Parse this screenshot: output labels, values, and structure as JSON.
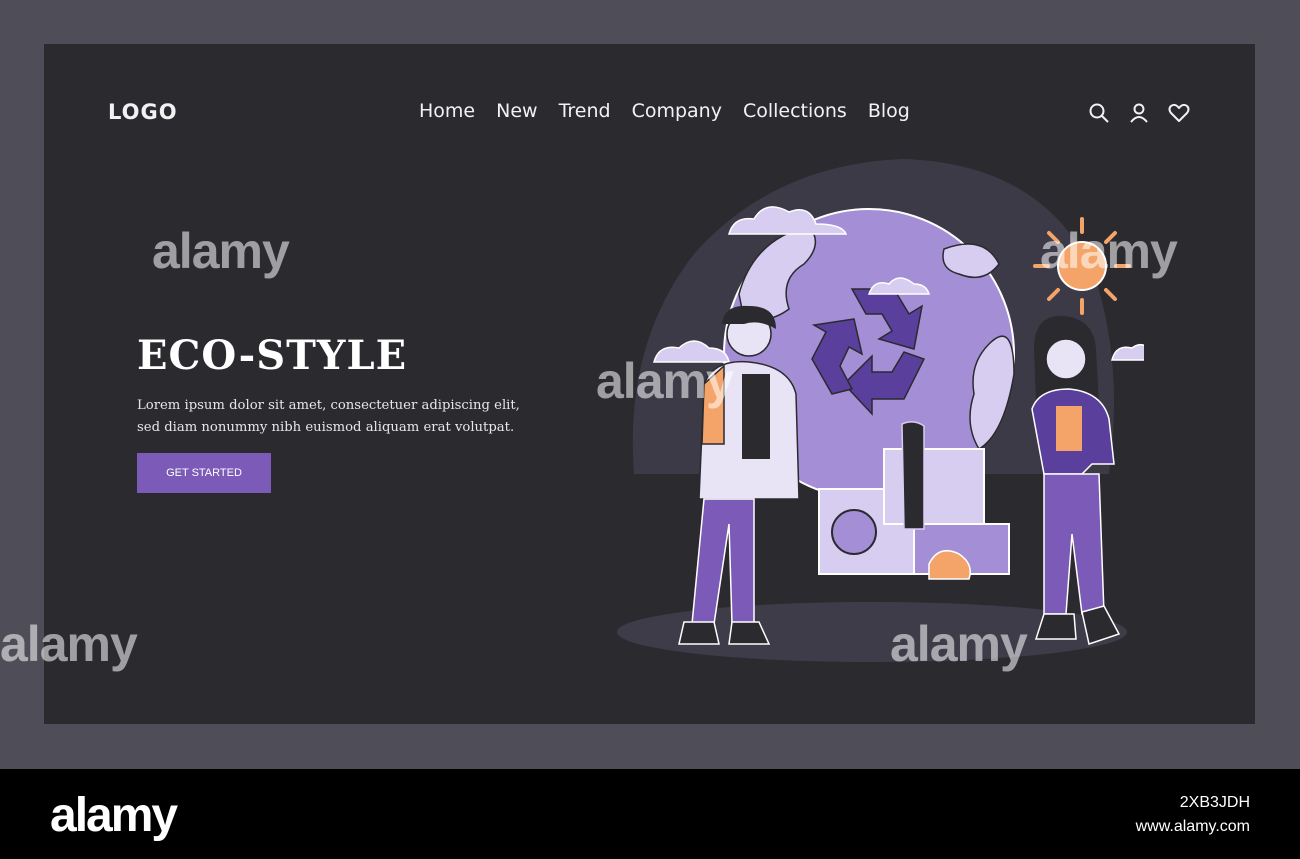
{
  "header": {
    "logo": "LOGO",
    "nav": [
      "Home",
      "New",
      "Trend",
      "Company",
      "Collections",
      "Blog"
    ],
    "icons": [
      "search-icon",
      "user-icon",
      "heart-icon"
    ]
  },
  "hero": {
    "title": "ECO-STYLE",
    "description": "Lorem ipsum dolor sit amet, consectetuer adipiscing elit, sed diam nonummy nibh euismod aliquam erat volutpat.",
    "cta_label": "GET STARTED"
  },
  "watermark": {
    "text": "alamy",
    "image_id": "2XB3JDH",
    "site": "www.alamy.com"
  },
  "colors": {
    "background": "#2b2a2f",
    "outer": "#4f4d57",
    "accent": "#7b5ab8",
    "globe": "#a48fd6",
    "sun": "#f4a468"
  }
}
